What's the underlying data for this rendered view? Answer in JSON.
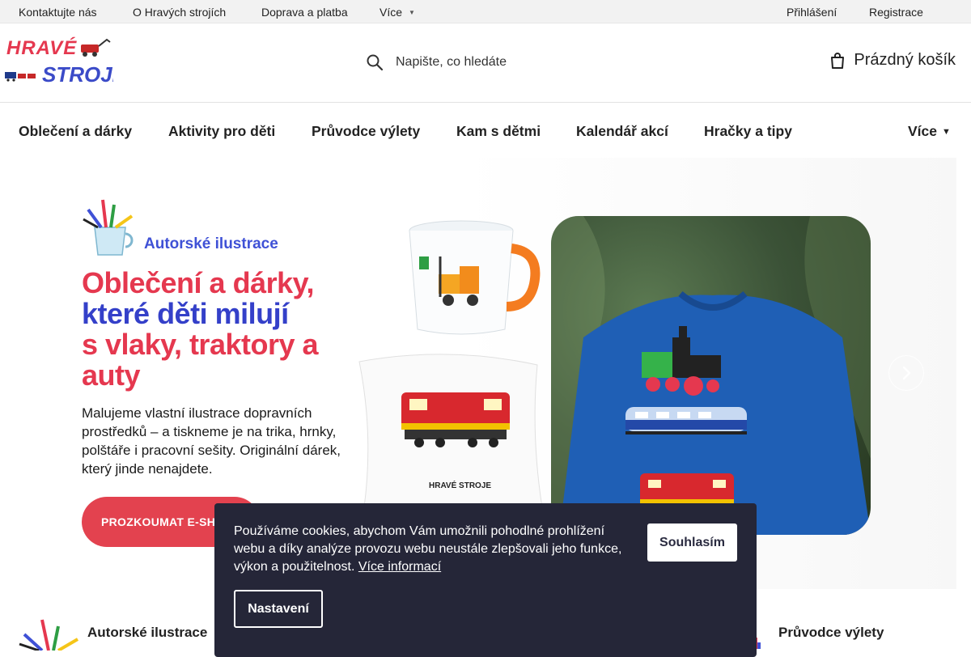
{
  "topbar": {
    "links": [
      "Kontaktujte nás",
      "O Hravých strojích",
      "Doprava a platba",
      "Více"
    ],
    "login": "Přihlášení",
    "register": "Registrace"
  },
  "header": {
    "logo_text": "HRAVÉ STROJE",
    "search_placeholder": "Napište, co hledáte",
    "cart_label": "Prázdný košík"
  },
  "nav": {
    "items": [
      "Oblečení a dárky",
      "Aktivity pro děti",
      "Průvodce výlety",
      "Kam s dětmi",
      "Kalendář akcí",
      "Hračky a tipy"
    ],
    "more": "Více"
  },
  "hero": {
    "subtitle": "Autorské ilustrace",
    "headline_1": "Oblečení a dárky,",
    "headline_2": "které děti milují",
    "headline_3": "s vlaky, traktory a auty",
    "description": "Malujeme vlastní ilustrace dopravních prostředků – a tiskneme je na trika, hrnky, polštáře i pracovní sešity. Originální dárek, který jinde nenajdete.",
    "cta": "PROZKOUMAT E-SHOP",
    "pillow_logo": "HRAVÉ STROJE"
  },
  "below": {
    "title_1": "Autorské ilustrace",
    "title_2": "Průvodce výlety"
  },
  "cookie": {
    "text": "Používáme cookies, abychom Vám umožnili pohodlné prohlížení webu a díky analýze provozu webu neustále zlepšovali jeho funkce, výkon a použitelnost.",
    "more_link": "Více informací",
    "accept": "Souhlasím",
    "settings": "Nastavení"
  },
  "colors": {
    "brand_red": "#e5384f",
    "brand_blue": "#3440c9",
    "cookie_bg": "#252638"
  }
}
